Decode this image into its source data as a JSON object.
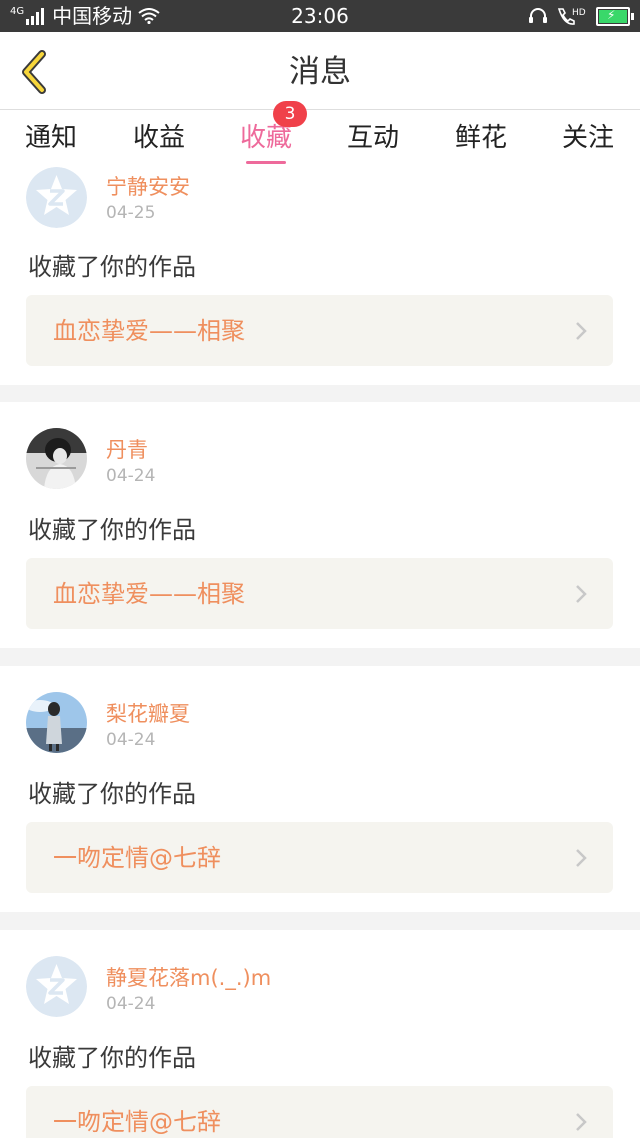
{
  "status_bar": {
    "network": "4G",
    "carrier": "中国移动",
    "time": "23:06",
    "hd": "HD"
  },
  "header": {
    "title": "消息"
  },
  "tabs": [
    {
      "label": "通知",
      "active": false
    },
    {
      "label": "收益",
      "active": false
    },
    {
      "label": "收藏",
      "active": true,
      "badge": "3"
    },
    {
      "label": "互动",
      "active": false
    },
    {
      "label": "鲜花",
      "active": false
    },
    {
      "label": "关注",
      "active": false
    }
  ],
  "colors": {
    "accent_pink": "#ee6a9b",
    "name_orange": "#ef8f5e",
    "badge_red": "#f0414a"
  },
  "messages": [
    {
      "name": "宁静安安",
      "date": "04-25",
      "action": "收藏了你的作品",
      "work": "血恋挚爱——相聚",
      "avatar": "default-qq-icon"
    },
    {
      "name": "丹青",
      "date": "04-24",
      "action": "收藏了你的作品",
      "work": "血恋挚爱——相聚",
      "avatar": "user-photo"
    },
    {
      "name": "梨花瓣夏",
      "date": "04-24",
      "action": "收藏了你的作品",
      "work": "一吻定情@七辞",
      "avatar": "user-photo"
    },
    {
      "name": "静夏花落m(._.)m",
      "date": "04-24",
      "action": "收藏了你的作品",
      "work": "一吻定情@七辞",
      "avatar": "default-qq-icon"
    }
  ]
}
